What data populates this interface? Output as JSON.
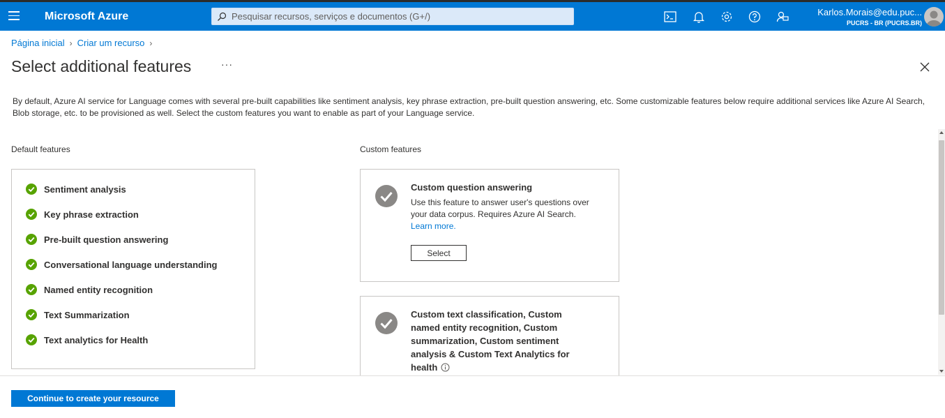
{
  "app": {
    "brand": "Microsoft Azure",
    "accent": "#0078d4"
  },
  "search": {
    "placeholder": "Pesquisar recursos, serviços e documentos (G+/)"
  },
  "toolbar": {
    "icons": [
      "cloud-shell-icon",
      "bell-icon",
      "gear-icon",
      "help-icon",
      "feedback-icon"
    ]
  },
  "user": {
    "email": "Karlos.Morais@edu.puc...",
    "tenant": "PUCRS - BR (PUCRS.BR)"
  },
  "breadcrumb": {
    "items": [
      "Página inicial",
      "Criar um recurso"
    ]
  },
  "page": {
    "title": "Select additional features",
    "more_label": "···",
    "description": "By default, Azure AI service for Language comes with several pre-built capabilities like sentiment analysis, key phrase extraction, pre-built question answering, etc. Some customizable features below require additional services like Azure AI Search, Blob storage, etc. to be provisioned as well. Select the custom features you want to enable as part of your Language service."
  },
  "default_features": {
    "label": "Default features",
    "items": [
      "Sentiment analysis",
      "Key phrase extraction",
      "Pre-built question answering",
      "Conversational language understanding",
      "Named entity recognition",
      "Text Summarization",
      "Text analytics for Health"
    ],
    "check_color": "#57a300"
  },
  "custom_features": {
    "label": "Custom features",
    "cards": [
      {
        "title": "Custom question answering",
        "description": "Use this feature to answer user's questions over your data corpus. Requires Azure AI Search.",
        "link": "Learn more.",
        "button": "Select"
      },
      {
        "title": "Custom text classification, Custom named entity recognition, Custom summarization, Custom sentiment analysis & Custom Text Analytics for health"
      }
    ]
  },
  "footer": {
    "continue_label": "Continue to create your resource"
  }
}
